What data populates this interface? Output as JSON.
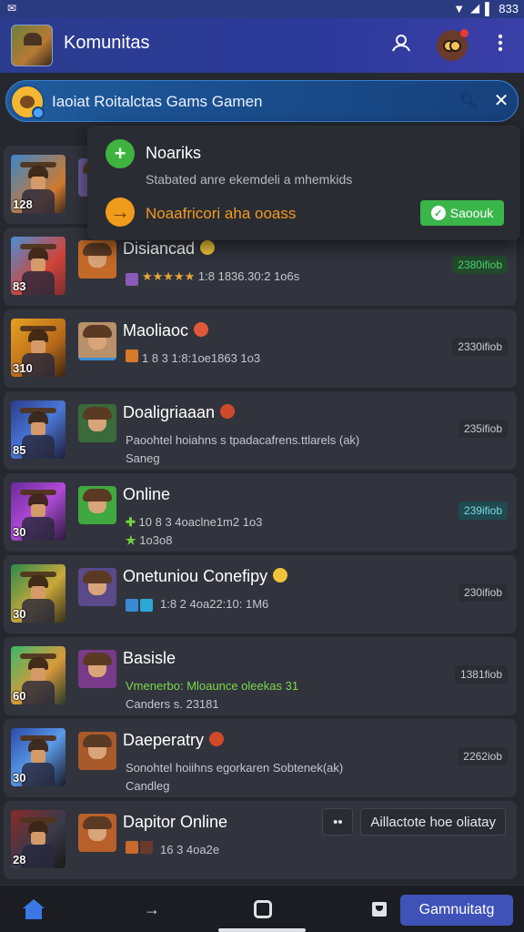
{
  "status": {
    "time": "833"
  },
  "appbar": {
    "title": "Komunitas"
  },
  "search": {
    "query": "Iaoiat Roitalctas Gams Gamen"
  },
  "popup": {
    "title": "Noariks",
    "subtitle": "Stabated anre ekemdeli a mhemkids",
    "warning": "Noaafricori aha ooass",
    "button": "Saoouk"
  },
  "list": [
    {
      "name": "",
      "line1": "",
      "line2": "",
      "badge": "",
      "num": "128"
    },
    {
      "name": "Disiancad",
      "line1": "1:8 1836.30:2 1o6s",
      "line2": "",
      "badge": "2380ifiob",
      "num": "83",
      "stars": "★★★★★"
    },
    {
      "name": "Maoliaoc",
      "line1": "1 8 3 1:8:1oe1863 1o3",
      "line2": "",
      "badge": "2330ifiob",
      "num": "310"
    },
    {
      "name": "Doaligriaaan",
      "line1": "Paoohtel hoiahns s tpadacafrens.ttlarels (ak)",
      "line2": "Saneg",
      "badge": "235ifiob",
      "num": "85"
    },
    {
      "name": "Online",
      "line1": "10 8 3 4oaclne1m2 1o3",
      "line2": "1o3o8",
      "badge": "239ifiob",
      "num": "30"
    },
    {
      "name": "Onetuniou Conefipy",
      "line1": "1:8 2 4oa22:10: 1M6",
      "line2": "",
      "badge": "230ifiob",
      "num": "30"
    },
    {
      "name": "Basisle",
      "line1": "Vmenerbo: Mloaunce oleekas 31",
      "line2": "Canders s. 23181",
      "badge": "1381fiob",
      "num": "60"
    },
    {
      "name": "Daeperatry",
      "line1": "Sonohtel hoiihns egorkaren Sobtenek(ak)",
      "line2": "Candleg",
      "badge": "2262iob",
      "num": "30"
    },
    {
      "name": "Dapitor Online",
      "line1": "16 3 4oa2e",
      "line2": "",
      "badge": "",
      "num": "28"
    }
  ],
  "last_actions": {
    "small": "••",
    "label": "Aillactote hoe oliatay"
  },
  "bottom": {
    "primary": "Gamnuitatg"
  },
  "colors": {
    "accent": "#3e52b8",
    "green": "#3ab54a",
    "orange": "#f29a1f",
    "appbar": "#2b3c8e"
  }
}
